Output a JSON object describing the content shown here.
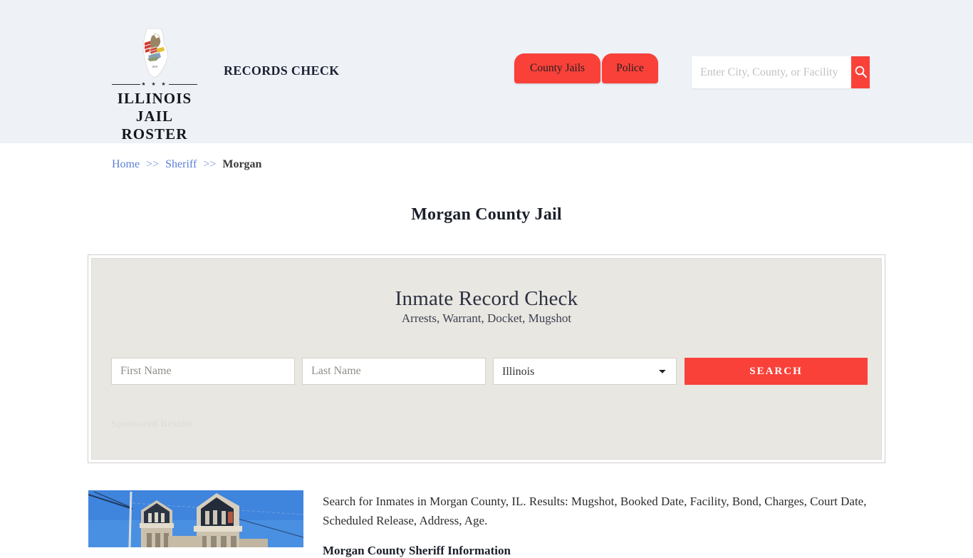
{
  "header": {
    "logo": {
      "icon": "illinois-state-outline-flag-icon",
      "stars": "★ ★ ★",
      "line1": "ILLINOIS",
      "line2": "JAIL ROSTER"
    },
    "tagline": "RECORDS CHECK",
    "nav": [
      {
        "label": "County Jails",
        "name": "nav-tab-county-jails"
      },
      {
        "label": "Police",
        "name": "nav-tab-police"
      }
    ],
    "search": {
      "placeholder": "Enter City, County, or Facility",
      "value": "",
      "button_icon": "search-icon"
    },
    "background_color": "#eef2f7"
  },
  "breadcrumb": {
    "home": "Home",
    "sep1": ">>",
    "sheriff": "Sheriff",
    "sep2": ">>",
    "current": "Morgan"
  },
  "page_title": "Morgan County Jail",
  "panel": {
    "heading": "Inmate Record Check",
    "subheading": "Arrests, Warrant, Docket, Mugshot",
    "form": {
      "first_name_placeholder": "First Name",
      "first_name_value": "",
      "last_name_placeholder": "Last Name",
      "last_name_value": "",
      "state_selected": "Illinois",
      "state_options": [
        "Illinois"
      ],
      "search_button": "SEARCH"
    },
    "sponsored_label": "Sponsored Results",
    "background_color": "#e9e7e2",
    "accent_color": "#f9413a"
  },
  "content": {
    "image_alt": "morgan-county-courthouse-photo",
    "paragraph": "Search for Inmates in Morgan County, IL. Results: Mugshot, Booked Date, Facility, Bond, Charges, Court Date, Scheduled Release, Address, Age.",
    "section_heading": "Morgan County Sheriff Information"
  }
}
